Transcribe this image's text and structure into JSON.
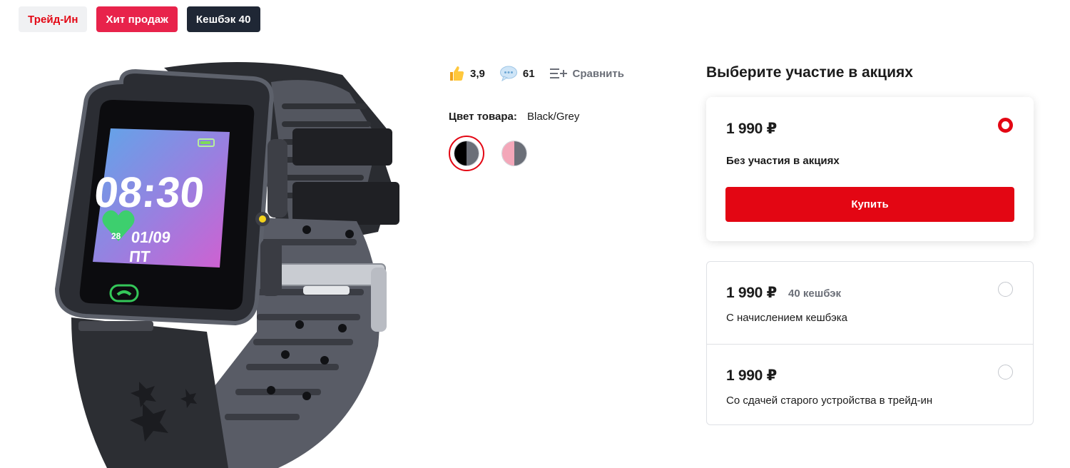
{
  "badges": {
    "trade_in": "Трейд-Ин",
    "hit": "Хит продаж",
    "cashback": "Кешбэк 40"
  },
  "product": {
    "image_icon": "smartwatch-image",
    "screen_time": "08:30",
    "screen_date": "01/09",
    "screen_day": "ПТ",
    "screen_heart": "28"
  },
  "meta": {
    "rating": "3,9",
    "reviews": "61",
    "compare_label": "Сравнить"
  },
  "color": {
    "label": "Цвет товара:",
    "value": "Black/Grey",
    "swatches": [
      {
        "left": "#000000",
        "right": "#6b6f78",
        "selected": true
      },
      {
        "left": "#f3a7b9",
        "right": "#6b6f78",
        "selected": false
      }
    ]
  },
  "offers": {
    "title": "Выберите участие в акциях",
    "items": [
      {
        "price": "1 990 ₽",
        "cashback": "",
        "desc": "Без участия в акциях",
        "selected": true
      },
      {
        "price": "1 990 ₽",
        "cashback": "40 кешбэк",
        "desc": "С начислением кешбэка",
        "selected": false
      },
      {
        "price": "1 990 ₽",
        "cashback": "",
        "desc": "Со сдачей старого устройства в трейд-ин",
        "selected": false
      }
    ],
    "buy_label": "Купить"
  },
  "colors": {
    "accent": "#e30613",
    "hit_badge": "#e8234b",
    "dark_badge": "#1f2735",
    "muted_text": "#6b6f78"
  }
}
